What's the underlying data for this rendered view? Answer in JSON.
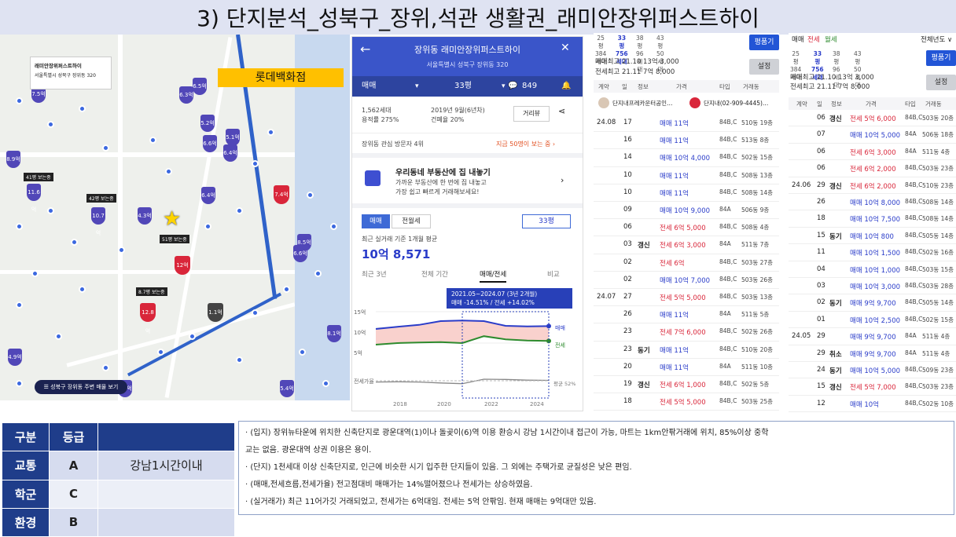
{
  "page_title": "3) 단지분석_성북구_장위,석관 생활권_래미안장위퍼스트하이",
  "map": {
    "card_title": "래미안장위퍼스트하이",
    "card_address": "서울특별시 성북구 장위동 320",
    "landmark_label": "롯데백화점",
    "bottom_button": "☰ 성북구 장위동 주변 매물 보기",
    "pins_blue": [
      "7.5억",
      "6.3억",
      "6.5억",
      "5.2억",
      "5.1억",
      "8.9억",
      "6.4억",
      "11.6억",
      "10.7억",
      "4.3억",
      "6.4억",
      "6.6억",
      "8.5억",
      "8.1억",
      "4.9억",
      "4.7억",
      "5.4억",
      "6.6억"
    ],
    "pins_red": [
      "7.4억",
      "12억",
      "12.8억"
    ],
    "pins_gray": [
      "1.1억"
    ],
    "boxes": [
      "41평 보는중",
      "42평 보는중",
      "51평 보는중",
      "8.7평 보는중"
    ]
  },
  "app": {
    "header_title": "장위동 래미안장위퍼스트하이",
    "header_subtitle": "서울특별시 성북구 장위동 320",
    "tab_trade": "매매",
    "tab_size": "33평",
    "tab_count": "849",
    "households": "1,562세대",
    "far": "용적률 275%",
    "built": "2019년 9월(6년차)",
    "bcr": "건폐율 20%",
    "distance_btn": "거리뷰",
    "visitors": "장위동 관심 방문자 4위",
    "visitors_link": "지금 50명이 보는 중 ›",
    "promo_title": "우리동네 부동산에 집 내놓기",
    "promo_text1": "가까운 부동산에 한 번에 집 내놓고",
    "promo_text2": "가장 쉽고 빠르게 거래해보세요!",
    "seg_trade": "매매",
    "seg_rent": "전월세",
    "size_select": "33평",
    "avg_label": "최근 실거래 기준 1개월 평균",
    "avg_value": "10억 8,571",
    "period_tabs": [
      "최근 3년",
      "전체 기간",
      "매매/전세",
      "비교"
    ],
    "tooltip_line1": "2021.05~2024.07 (3년 2개월)",
    "tooltip_line2": "매매 -14.51% / 전세 +14.02%",
    "y_ticks": [
      "15억",
      "10억",
      "5억"
    ],
    "gap_label": "전세가율",
    "legend": [
      "매매",
      "전세",
      "평균 52%"
    ],
    "x_ticks": [
      "2018",
      "2020",
      "2022",
      "2024"
    ]
  },
  "chart_data": {
    "type": "line",
    "x": [
      "2018",
      "2019",
      "2020",
      "2021",
      "2021.05",
      "2022",
      "2023",
      "2024",
      "2024.07"
    ],
    "series": [
      {
        "name": "매매",
        "values": [
          9.5,
          10.2,
          10.8,
          12.0,
          12.2,
          12.0,
          10.5,
          10.3,
          10.4
        ]
      },
      {
        "name": "전세",
        "values": [
          4.5,
          5.0,
          5.2,
          5.3,
          5.0,
          7.2,
          6.2,
          5.8,
          5.7
        ]
      }
    ],
    "ylim": [
      0,
      15
    ],
    "yticks": [
      "5억",
      "10억",
      "15억"
    ]
  },
  "table1": {
    "size_tabs": [
      [
        "25평",
        "384세대"
      ],
      [
        "33평",
        "756세대"
      ],
      [
        "38평",
        "96세대"
      ],
      [
        "43평",
        "50세대"
      ]
    ],
    "btn_size": "평품기",
    "highest_trade": "매매최고 21.10 13억 3,000",
    "highest_rent": "전세최고 21.11 7억 8,000",
    "btn_setting": "설정",
    "headers": [
      "계약",
      "일",
      "정보",
      "가격",
      "타입",
      "거래동"
    ],
    "agent1": "단지내프레카운터공인…",
    "agent2": "단지내(02-909-4445)…",
    "rows": [
      [
        "24.08",
        "17",
        "",
        "매매 11억",
        "84B,C",
        "510동 19층"
      ],
      [
        "",
        "16",
        "",
        "매매 11억",
        "84B,C",
        "513동 8층"
      ],
      [
        "",
        "14",
        "",
        "매매 10억 4,000",
        "84B,C",
        "502동 15층"
      ],
      [
        "",
        "10",
        "",
        "매매 11억",
        "84B,C",
        "508동 13층"
      ],
      [
        "",
        "10",
        "",
        "매매 11억",
        "84B,C",
        "508동 14층"
      ],
      [
        "",
        "09",
        "",
        "매매 10억 9,000",
        "84A",
        "506동 9층"
      ],
      [
        "",
        "06",
        "",
        "전세 6억 5,000",
        "84B,C",
        "508동 4층"
      ],
      [
        "",
        "03",
        "갱신",
        "전세 6억 3,000",
        "84A",
        "511동 7층"
      ],
      [
        "",
        "02",
        "",
        "전세 6억",
        "84B,C",
        "503동 27층"
      ],
      [
        "",
        "02",
        "",
        "매매 10억 7,000",
        "84B,C",
        "503동 26층"
      ],
      [
        "24.07",
        "27",
        "",
        "전세 5억 5,000",
        "84B,C",
        "503동 13층"
      ],
      [
        "",
        "26",
        "",
        "매매 11억",
        "84A",
        "511동 5층"
      ],
      [
        "",
        "23",
        "",
        "전세 7억 6,000",
        "84B,C",
        "502동 26층"
      ],
      [
        "",
        "23",
        "동기",
        "매매 11억",
        "84B,C",
        "510동 20층"
      ],
      [
        "",
        "20",
        "",
        "매매 11억",
        "84A",
        "511동 10층"
      ],
      [
        "",
        "19",
        "갱신",
        "전세 6억 1,000",
        "84B,C",
        "502동 5층"
      ],
      [
        "",
        "18",
        "",
        "전세 5억 5,000",
        "84B,C",
        "503동 25층"
      ]
    ]
  },
  "table2": {
    "top_tabs": [
      "매매",
      "전세",
      "월세"
    ],
    "year_select": "전체년도 ∨",
    "size_tabs": [
      [
        "25평",
        "384세대"
      ],
      [
        "33평",
        "756세대"
      ],
      [
        "38평",
        "96세대"
      ],
      [
        "43평",
        "50세대"
      ]
    ],
    "btn_size": "평품기",
    "highest_trade": "매매최고 21.10 13억 3,000",
    "highest_rent": "전세최고 21.11 7억 8,000",
    "btn_setting": "설정",
    "headers": [
      "계약",
      "일",
      "정보",
      "가격",
      "타입",
      "거래동"
    ],
    "rows": [
      [
        "",
        "06",
        "갱신",
        "전세 5억 6,000",
        "84B,C",
        "503동 20층"
      ],
      [
        "",
        "07",
        "",
        "매매 10억 5,000",
        "84A",
        "506동 18층"
      ],
      [
        "",
        "06",
        "",
        "전세 6억 3,000",
        "84A",
        "511동 4층"
      ],
      [
        "",
        "06",
        "",
        "전세 6억 2,000",
        "84B,C",
        "503동 23층"
      ],
      [
        "24.06",
        "29",
        "갱신",
        "전세 6억 2,000",
        "84B,C",
        "510동 23층"
      ],
      [
        "",
        "26",
        "",
        "매매 10억 8,000",
        "84B,C",
        "508동 14층"
      ],
      [
        "",
        "18",
        "",
        "매매 10억 7,500",
        "84B,C",
        "508동 14층"
      ],
      [
        "",
        "15",
        "동기",
        "매매 10억 800",
        "84B,C",
        "505동 14층"
      ],
      [
        "",
        "11",
        "",
        "매매 10억 1,500",
        "84B,C",
        "502동 16층"
      ],
      [
        "",
        "04",
        "",
        "매매 10억 1,000",
        "84B,C",
        "503동 15층"
      ],
      [
        "",
        "03",
        "",
        "매매 10억 3,000",
        "84B,C",
        "503동 28층"
      ],
      [
        "",
        "02",
        "동기",
        "매매 9억 9,700",
        "84B,C",
        "505동 14층"
      ],
      [
        "",
        "01",
        "",
        "매매 10억 2,500",
        "84B,C",
        "502동 15층"
      ],
      [
        "24.05",
        "29",
        "",
        "매매 9억 9,700",
        "84A",
        "511동 4층"
      ],
      [
        "",
        "29",
        "취소",
        "매매 9억 9,700",
        "84A",
        "511동 4층"
      ],
      [
        "",
        "24",
        "동기",
        "매매 10억 5,000",
        "84B,C",
        "509동 23층"
      ],
      [
        "",
        "15",
        "갱신",
        "전세 5억 7,000",
        "84B,C",
        "503동 23층"
      ],
      [
        "",
        "12",
        "",
        "매매 10억",
        "84B,C",
        "502동 10층"
      ]
    ]
  },
  "grade_table": {
    "headers": [
      "구분",
      "등급",
      ""
    ],
    "rows": [
      [
        "교통",
        "A",
        "강남1시간이내"
      ],
      [
        "학군",
        "C",
        ""
      ],
      [
        "환경",
        "B",
        ""
      ]
    ]
  },
  "notes": [
    "· (입지) 장위뉴타운에 위치한 신축단지로 광운대역(1)이나 돌곶이(6)역 이용 환승시 강남 1시간이내 접근이 가능, 마트는 1km안팎거래에 위치, 85%이상 중학",
    "교는 없음. 광운대역 상권 이용은 용이.",
    " · (단지) 1천세대 이상 신축단지로, 인근에 비슷한 시기 입주한 단지들이 있음. 그 외에는 주택가로 균질성은 낮은 편임.",
    "· (매매,전세흐름,전세가율) 전고점대비 매매가는 14%떨어졌으나 전세가는 상승하였음.",
    "· (실거래가) 최근 11어가깃 거래되었고, 전세가는 6억대임. 전세는 5억 안팎임. 현재 매매는 9억대만 있음."
  ]
}
